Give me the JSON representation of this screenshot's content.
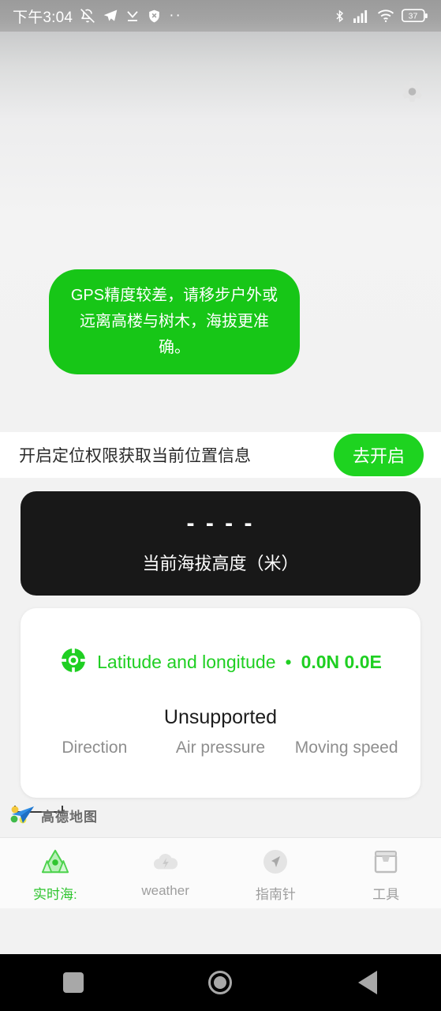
{
  "statusbar": {
    "time": "下午3:04",
    "overflow": "··",
    "battery_level": "37",
    "icons": [
      "bell-muted-icon",
      "telegram-icon",
      "download-complete-icon",
      "shield-off-icon",
      "more-dots-icon",
      "bluetooth-icon",
      "cellular-signal-icon",
      "wifi-icon",
      "battery-icon"
    ]
  },
  "map": {
    "settings_icon": "gear-icon",
    "toast": "GPS精度较差，请移步户外或远离高楼与树木，海拔更准确。",
    "toast_color": "#17c617"
  },
  "permission": {
    "message": "开启定位权限获取当前位置信息",
    "button_label": "去开启",
    "button_color": "#1ed320"
  },
  "altitude": {
    "value": "- - - -",
    "label": "当前海拔高度（米）",
    "card_color": "#181818"
  },
  "info": {
    "latlon_icon": "gps-target-icon",
    "latlon_label": "Latitude and longitude",
    "separator": "•",
    "latlon_value": "0.0N 0.0E",
    "accent_color": "#1fcf22",
    "status": "Unsupported",
    "metrics": [
      {
        "label": "Direction"
      },
      {
        "label": "Air pressure"
      },
      {
        "label": "Moving speed"
      }
    ]
  },
  "attribution": {
    "logo": "amap-logo-icon",
    "text": "高德地图"
  },
  "bottom_nav": {
    "items": [
      {
        "label": "实时海:",
        "icon": "mountain-icon",
        "active": true
      },
      {
        "label": "weather",
        "icon": "cloud-lightning-icon",
        "active": false
      },
      {
        "label": "指南针",
        "icon": "compass-icon",
        "active": false
      },
      {
        "label": "工具",
        "icon": "toolbox-icon",
        "active": false
      }
    ]
  },
  "android_nav": {
    "recents": "square-recents-icon",
    "home": "circle-home-icon",
    "back": "triangle-back-icon"
  }
}
